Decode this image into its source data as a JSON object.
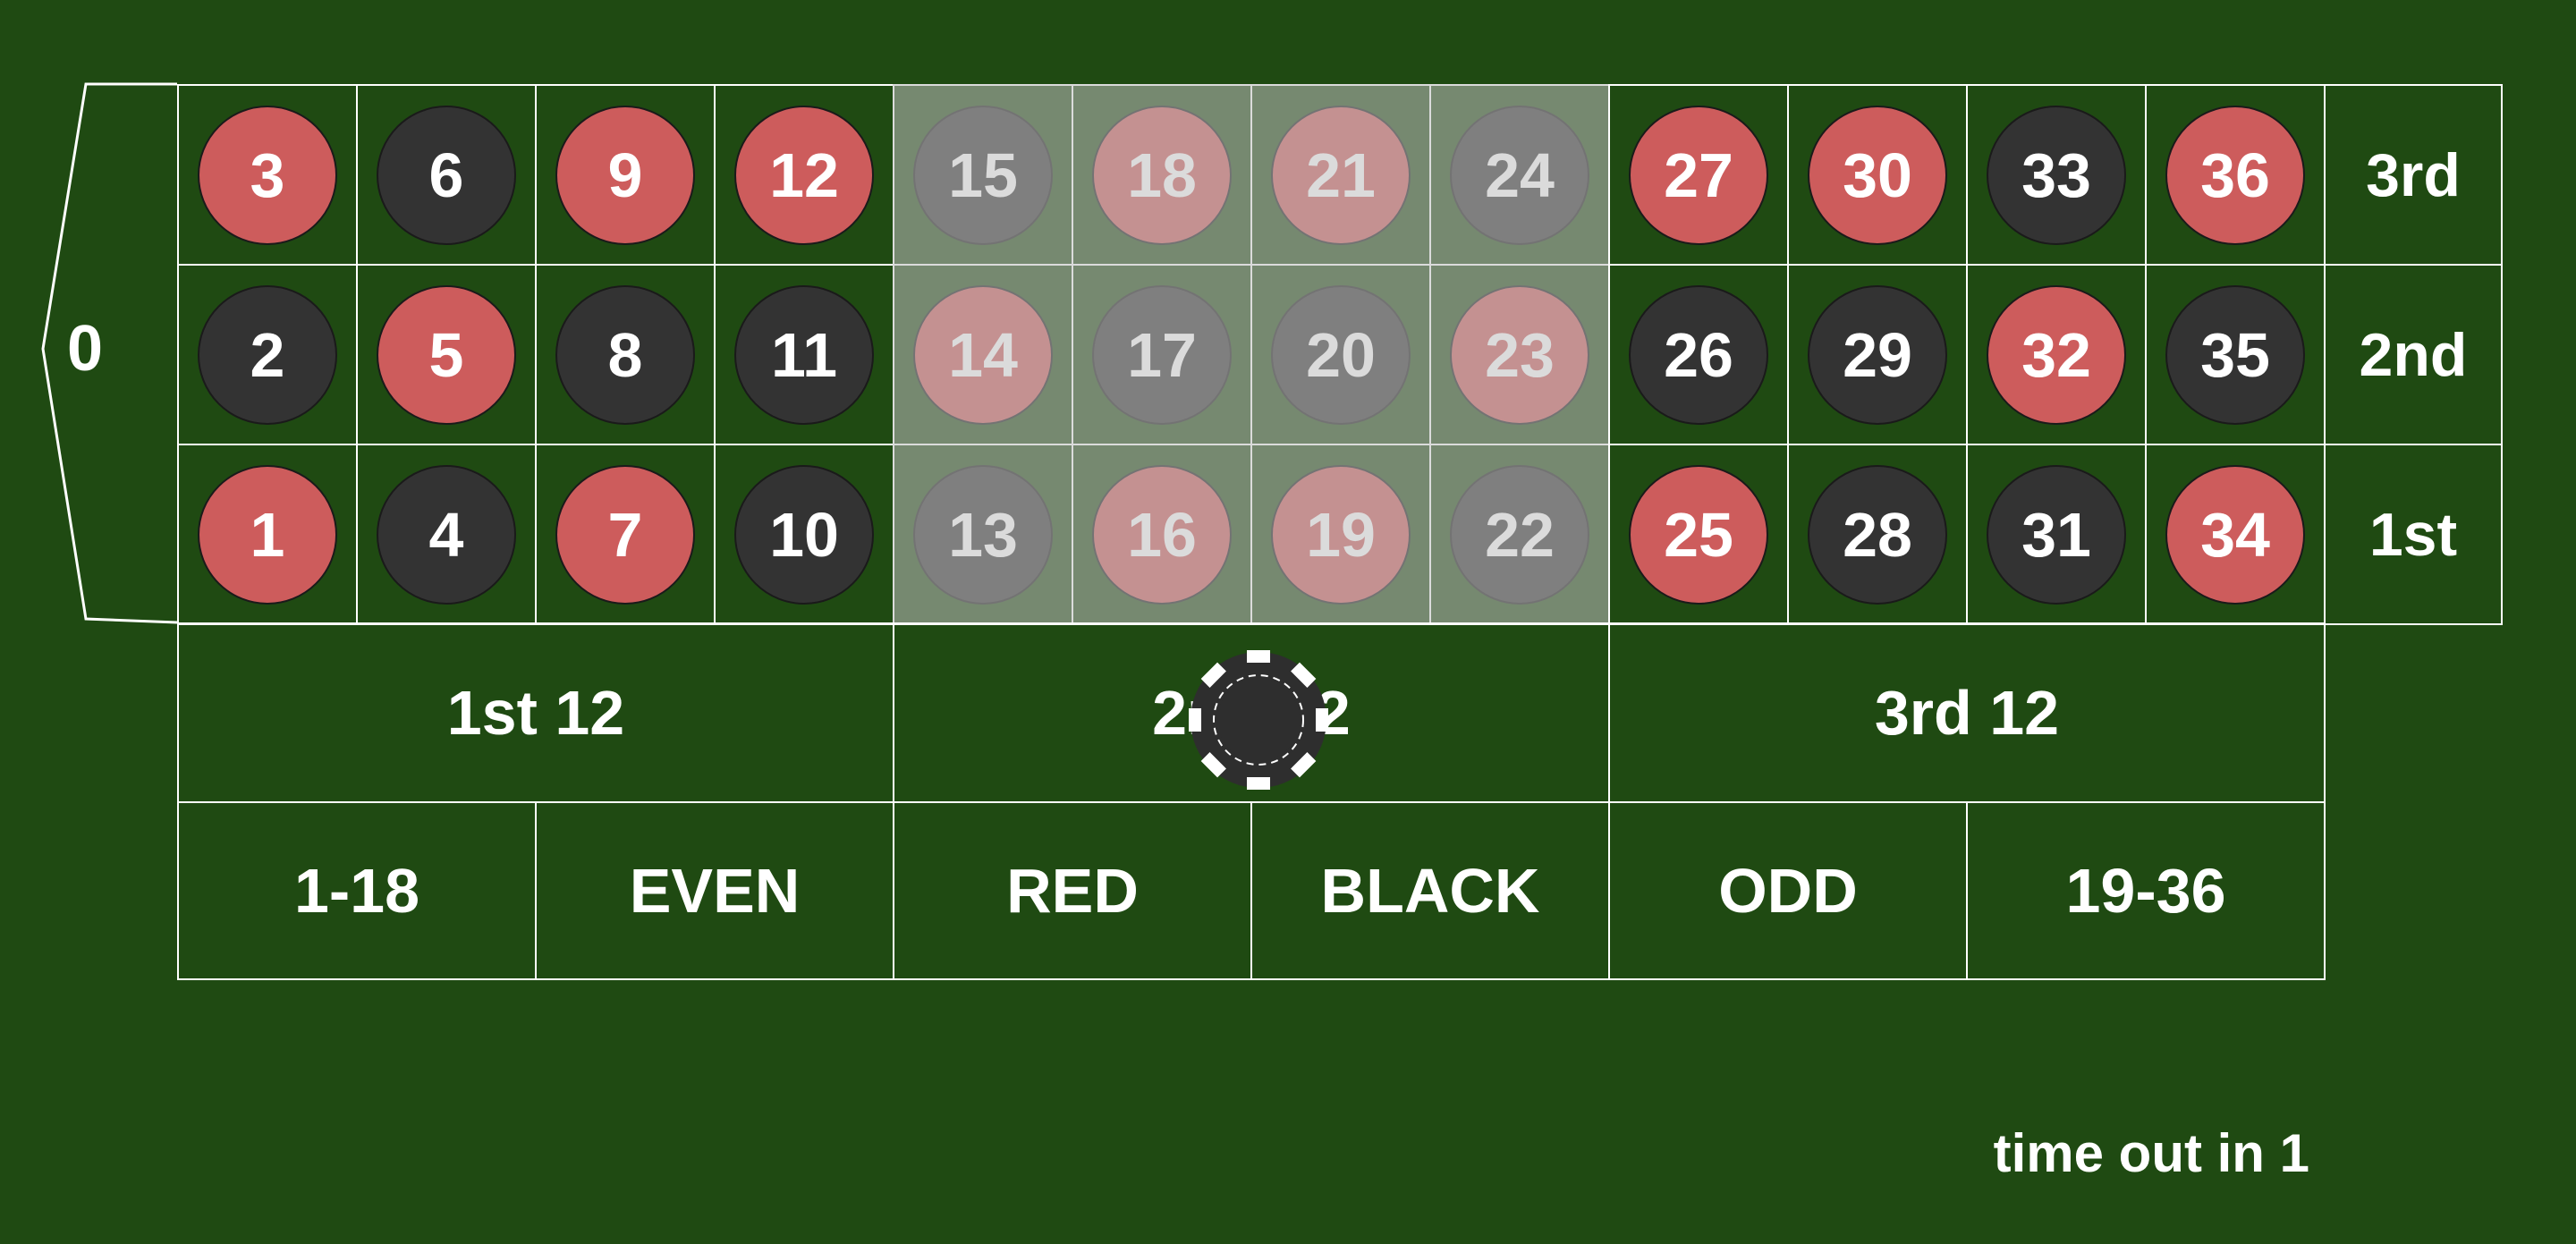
{
  "zero": {
    "label": "0",
    "color": "green"
  },
  "rows": [
    [
      {
        "n": "3",
        "c": "red"
      },
      {
        "n": "6",
        "c": "black"
      },
      {
        "n": "9",
        "c": "red"
      },
      {
        "n": "12",
        "c": "red"
      },
      {
        "n": "15",
        "c": "black"
      },
      {
        "n": "18",
        "c": "red"
      },
      {
        "n": "21",
        "c": "red"
      },
      {
        "n": "24",
        "c": "black"
      },
      {
        "n": "27",
        "c": "red"
      },
      {
        "n": "30",
        "c": "red"
      },
      {
        "n": "33",
        "c": "black"
      },
      {
        "n": "36",
        "c": "red"
      }
    ],
    [
      {
        "n": "2",
        "c": "black"
      },
      {
        "n": "5",
        "c": "red"
      },
      {
        "n": "8",
        "c": "black"
      },
      {
        "n": "11",
        "c": "black"
      },
      {
        "n": "14",
        "c": "red"
      },
      {
        "n": "17",
        "c": "black"
      },
      {
        "n": "20",
        "c": "black"
      },
      {
        "n": "23",
        "c": "red"
      },
      {
        "n": "26",
        "c": "black"
      },
      {
        "n": "29",
        "c": "black"
      },
      {
        "n": "32",
        "c": "red"
      },
      {
        "n": "35",
        "c": "black"
      }
    ],
    [
      {
        "n": "1",
        "c": "red"
      },
      {
        "n": "4",
        "c": "black"
      },
      {
        "n": "7",
        "c": "red"
      },
      {
        "n": "10",
        "c": "black"
      },
      {
        "n": "13",
        "c": "black"
      },
      {
        "n": "16",
        "c": "red"
      },
      {
        "n": "19",
        "c": "red"
      },
      {
        "n": "22",
        "c": "black"
      },
      {
        "n": "25",
        "c": "red"
      },
      {
        "n": "28",
        "c": "black"
      },
      {
        "n": "31",
        "c": "black"
      },
      {
        "n": "34",
        "c": "red"
      }
    ]
  ],
  "columns": [
    "3rd",
    "2nd",
    "1st"
  ],
  "dozens": [
    "1st 12",
    "2nd 12",
    "3rd 12"
  ],
  "even_money": [
    "1-18",
    "EVEN",
    "RED",
    "BLACK",
    "ODD",
    "19-36"
  ],
  "highlighted_dozen": "2nd 12",
  "chip": {
    "on": "2nd 12",
    "color": "black"
  },
  "timer": {
    "text": "time out in 1"
  },
  "colors": {
    "felt": "#1f4a12",
    "red": "#cd5c5c",
    "black": "#333333",
    "line": "#ffffff"
  }
}
